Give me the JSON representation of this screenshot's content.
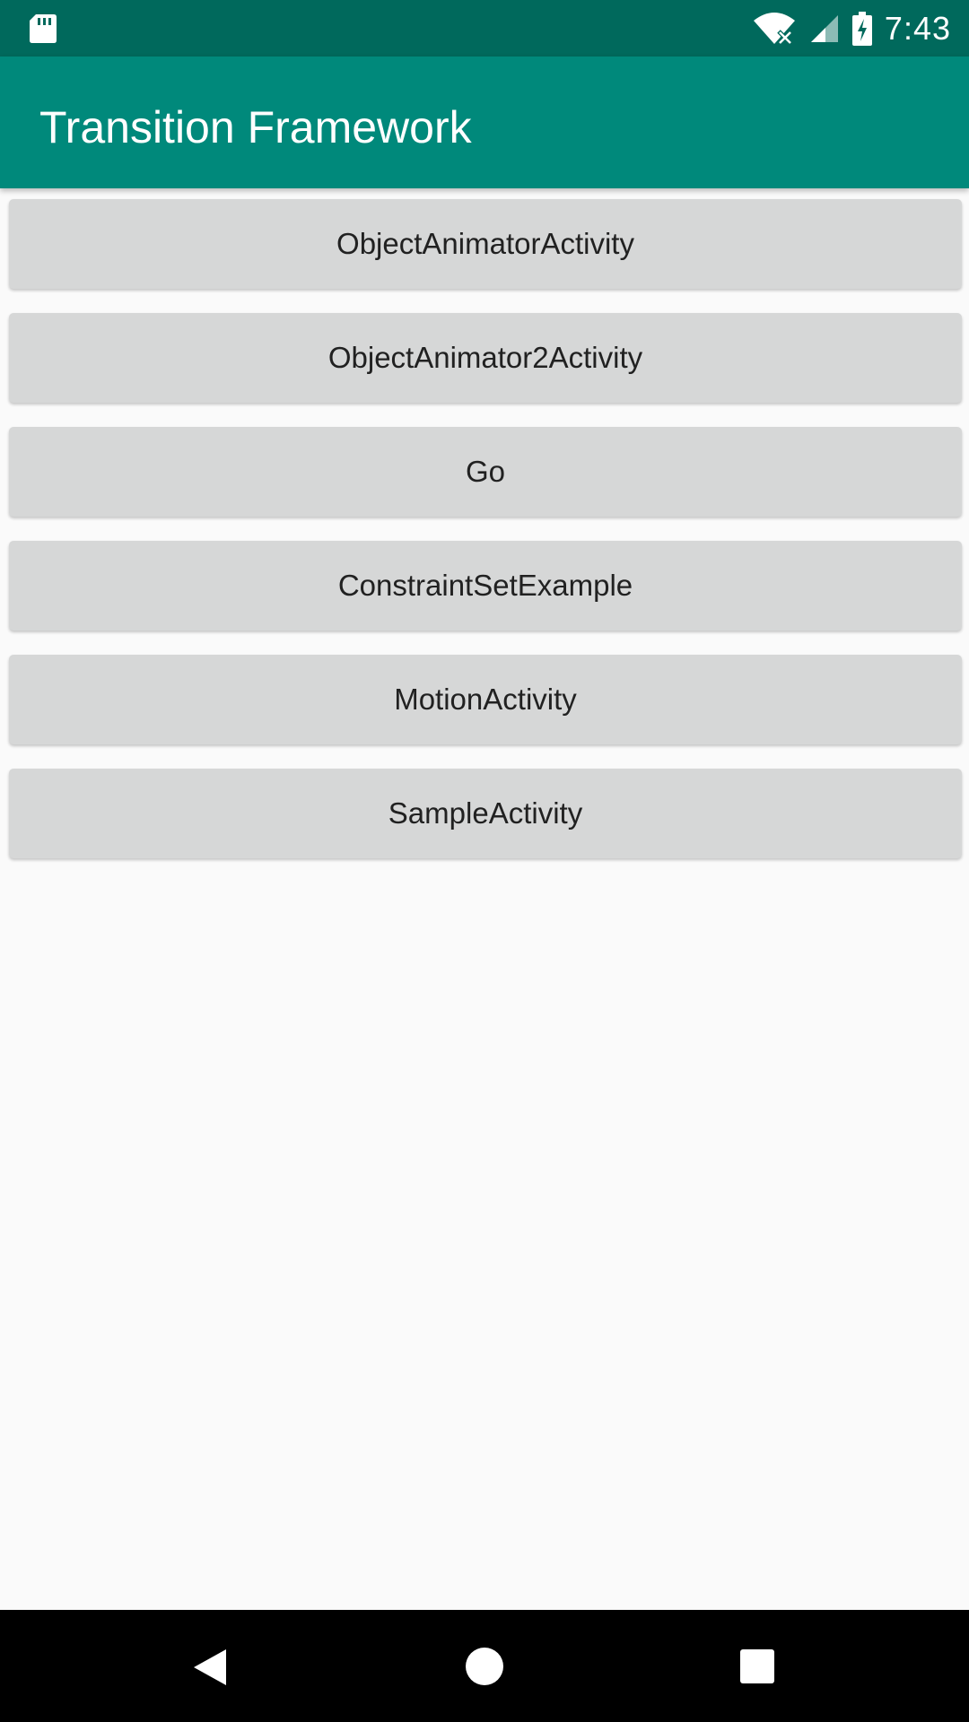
{
  "status_bar": {
    "time": "7:43",
    "icons": [
      "sd-card-icon",
      "wifi-icon",
      "signal-icon",
      "battery-charging-icon"
    ]
  },
  "app_bar": {
    "title": "Transition Framework",
    "color": "#00897b"
  },
  "buttons": [
    {
      "label": "ObjectAnimatorActivity"
    },
    {
      "label": "ObjectAnimator2Activity"
    },
    {
      "label": "Go"
    },
    {
      "label": "ConstraintSetExample"
    },
    {
      "label": "MotionActivity"
    },
    {
      "label": "SampleActivity"
    }
  ],
  "nav_bar": {
    "icons": [
      "back-icon",
      "home-icon",
      "recents-icon"
    ]
  },
  "colors": {
    "status_bar": "#00695c",
    "button_bg": "#d6d7d7",
    "background": "#fafafa"
  }
}
